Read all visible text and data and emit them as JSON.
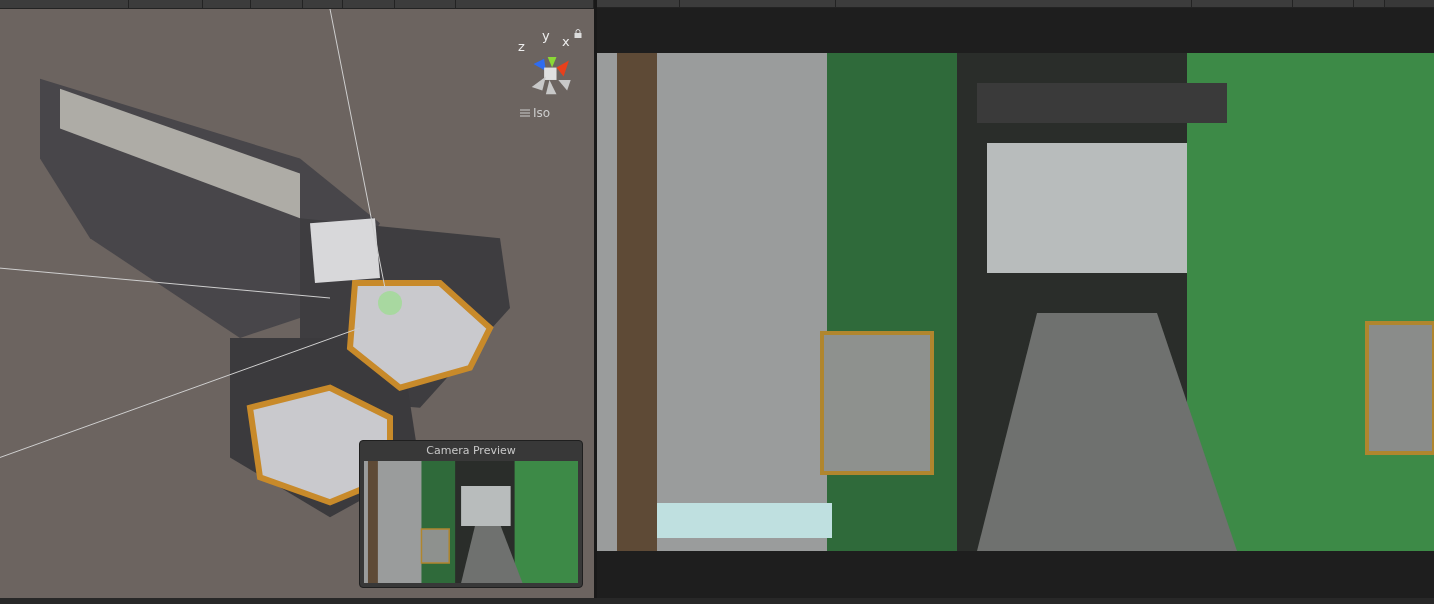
{
  "scene_view": {
    "gizmo": {
      "axes": [
        {
          "label": "x",
          "color": "#e8401c"
        },
        {
          "label": "y",
          "color": "#8ad836"
        },
        {
          "label": "z",
          "color": "#2f6cf0"
        }
      ],
      "projection": "Iso"
    },
    "camera_preview": {
      "title": "Camera Preview",
      "kind": "picture"
    }
  }
}
